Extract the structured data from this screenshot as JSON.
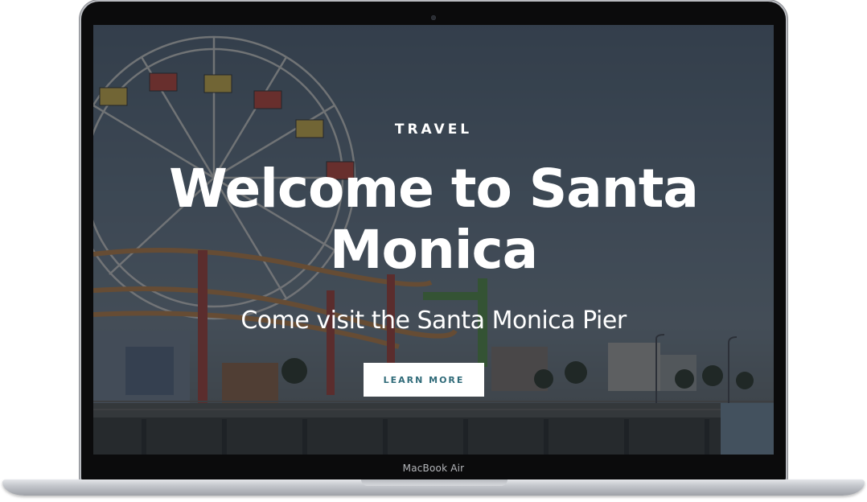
{
  "device": {
    "brand_label": "MacBook Air"
  },
  "hero": {
    "eyebrow": "TRAVEL",
    "headline": "Welcome to Santa Monica",
    "subhead": "Come visit the Santa Monica Pier",
    "cta_label": "LEARN MORE"
  },
  "colors": {
    "cta_text": "#2f6a78",
    "cta_background": "#ffffff",
    "hero_text": "#ffffff",
    "overlay": "rgba(20,26,34,0.55)"
  }
}
